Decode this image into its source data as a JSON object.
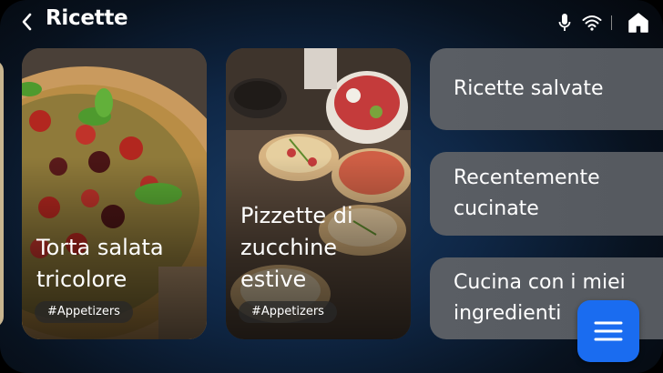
{
  "header": {
    "title": "Ricette"
  },
  "cards": [
    {
      "title": "Torta salata\ntricolore",
      "tag": "#Appetizers"
    },
    {
      "title": "Pizzette di\nzucchine\nestive",
      "tag": "#Appetizers"
    }
  ],
  "menu": [
    {
      "label": "Ricette salvate"
    },
    {
      "label": "Recentemente\ncucinate"
    },
    {
      "label": "Cucina con i miei\ningredienti"
    }
  ],
  "colors": {
    "accent": "#1a6cf0",
    "menu_bg": "#5a5e64"
  },
  "icons": [
    "back-arrow-icon",
    "microphone-icon",
    "wifi-icon",
    "home-icon",
    "menu-icon"
  ]
}
